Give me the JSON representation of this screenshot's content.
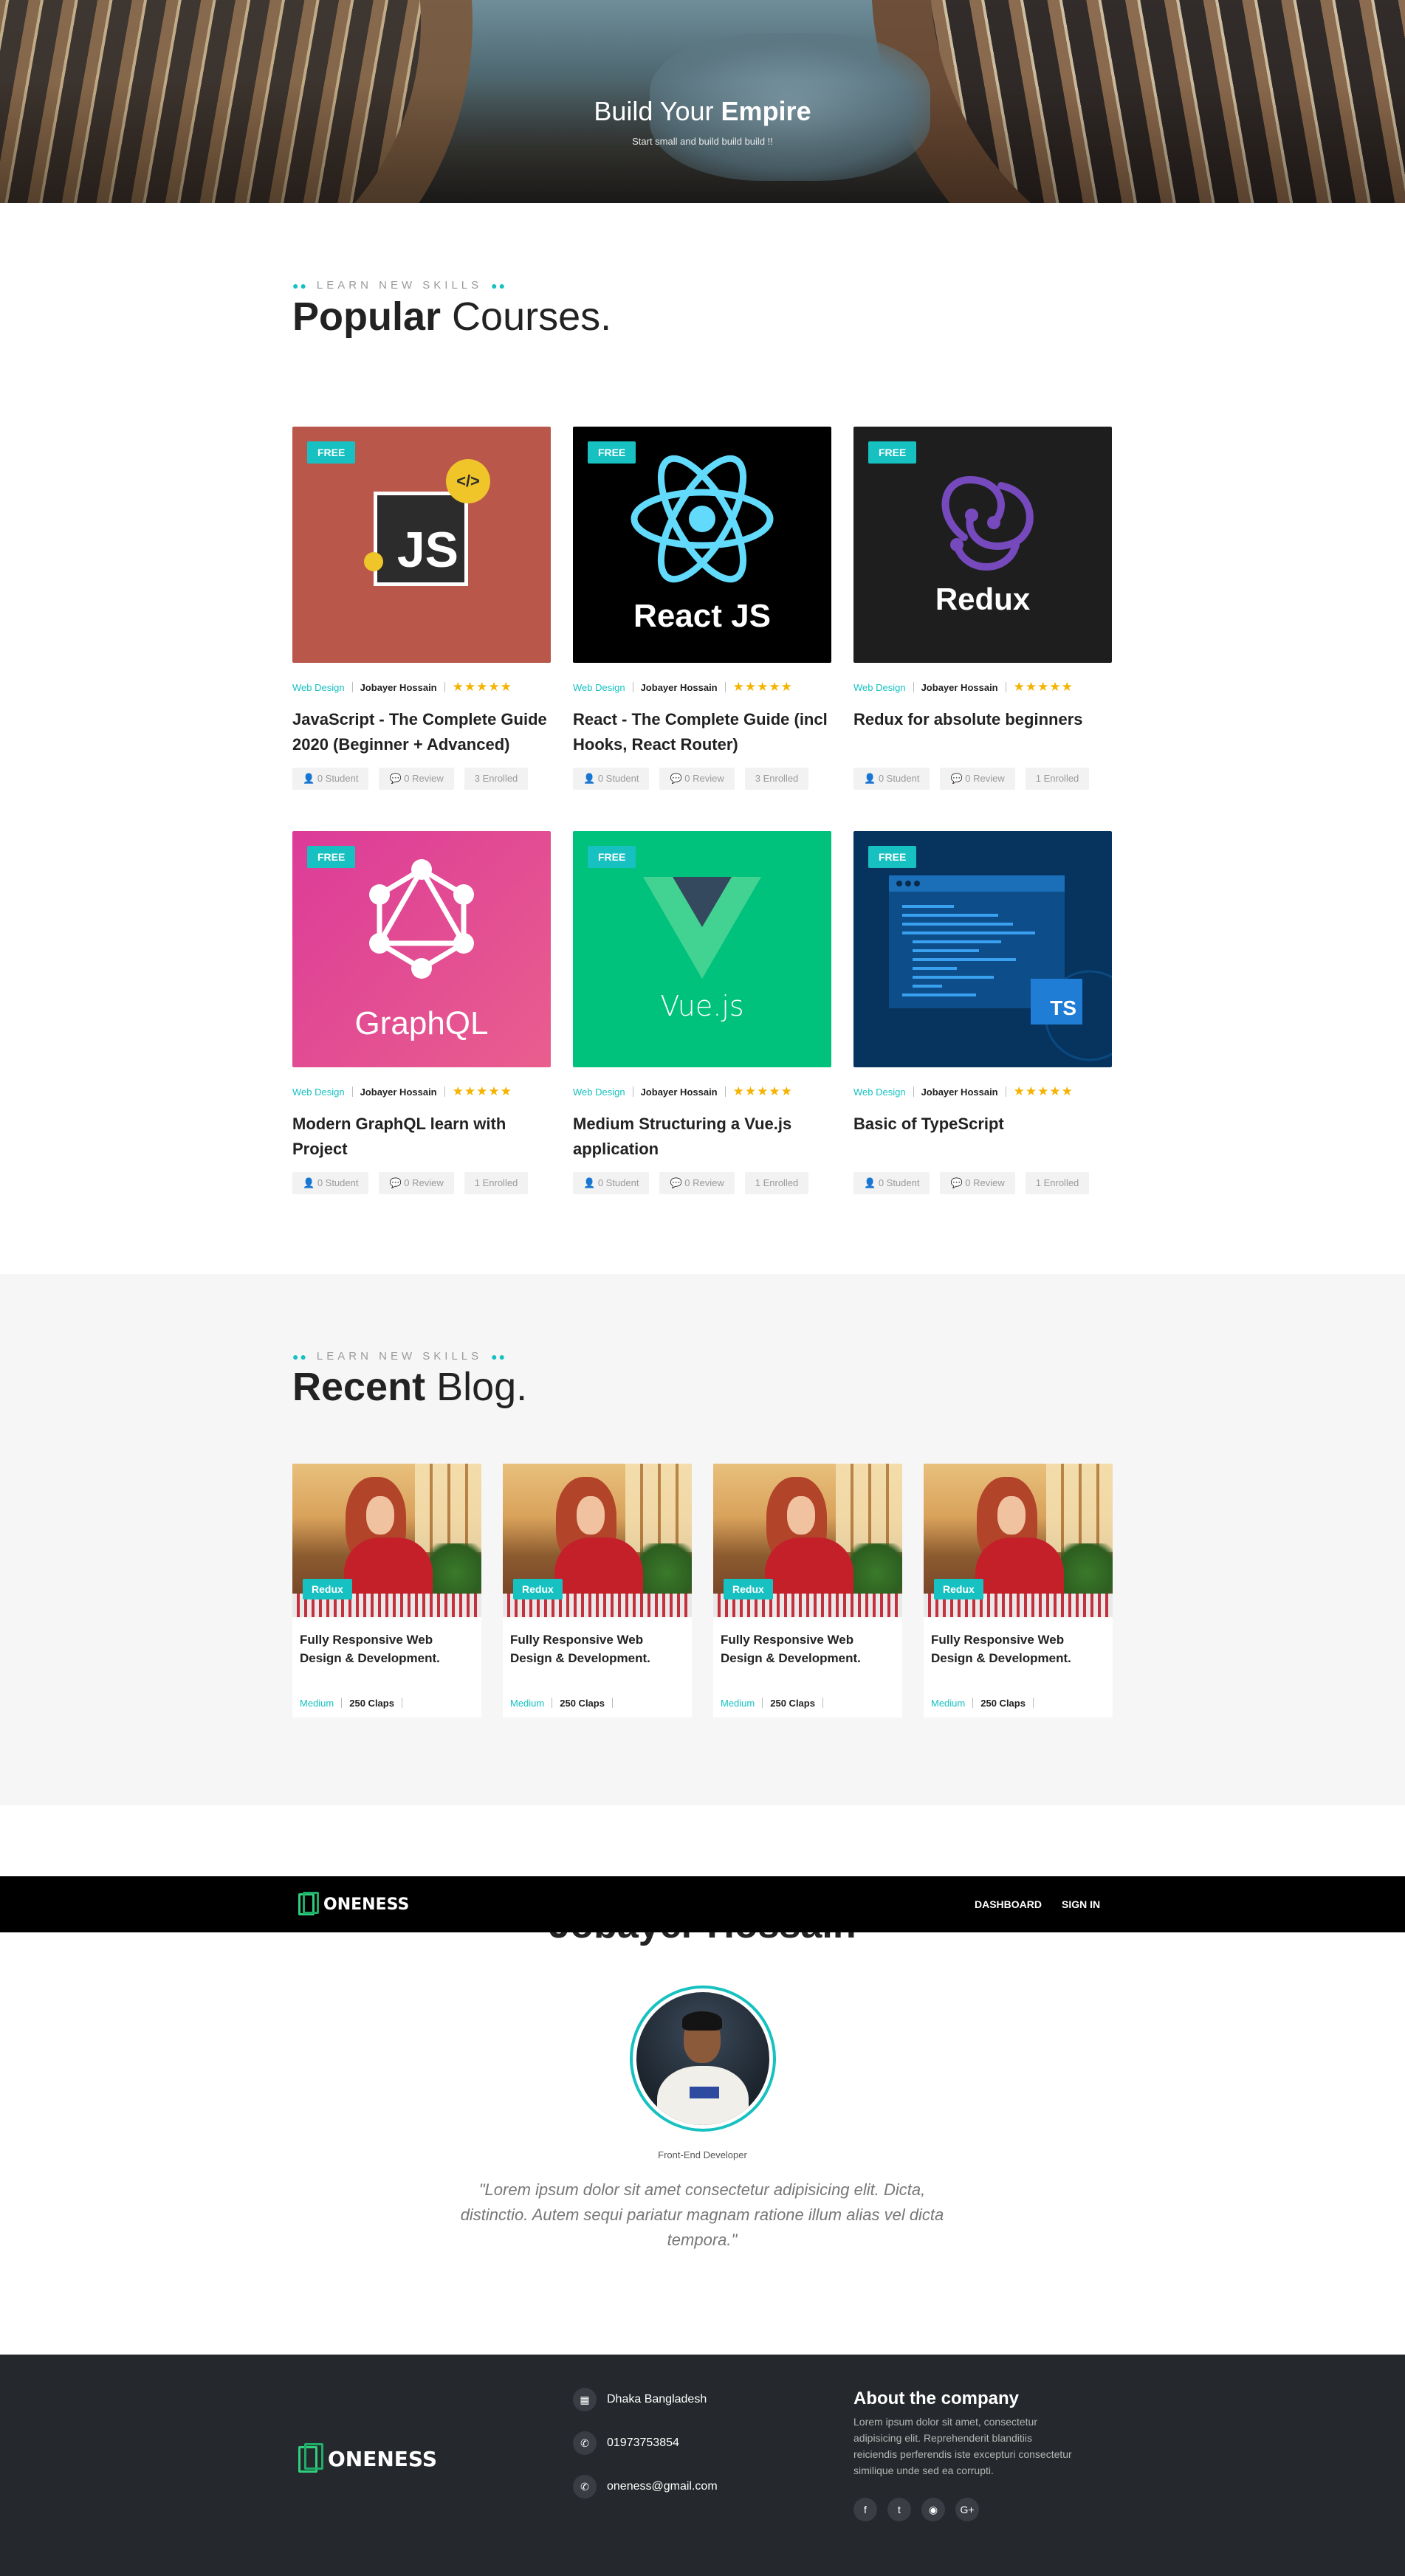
{
  "hero": {
    "title_prefix": "Build Your",
    "title_bold": "Empire",
    "subtitle": "Start small and build build build !!"
  },
  "courses_section": {
    "kicker": "LEARN NEW SKILLS",
    "title_bold": "Popular",
    "title_rest": "Courses."
  },
  "courses": [
    {
      "badge": "FREE",
      "image": "JS",
      "category": "Web Design",
      "author": "Jobayer Hossain",
      "rating": 5,
      "stars": "★★★★★",
      "title": "JavaScript - The Complete Guide 2020 (Beginner + Advanced)",
      "students": "0 Student",
      "reviews": "0 Review",
      "enrolled": "3 Enrolled"
    },
    {
      "badge": "FREE",
      "image": "React JS",
      "category": "Web Design",
      "author": "Jobayer Hossain",
      "rating": 5,
      "stars": "★★★★★",
      "title": "React - The Complete Guide (incl Hooks, React Router)",
      "students": "0 Student",
      "reviews": "0 Review",
      "enrolled": "3 Enrolled"
    },
    {
      "badge": "FREE",
      "image": "Redux",
      "category": "Web Design",
      "author": "Jobayer Hossain",
      "rating": 5,
      "stars": "★★★★★",
      "title": "Redux for absolute beginners",
      "students": "0 Student",
      "reviews": "0 Review",
      "enrolled": "1 Enrolled"
    },
    {
      "badge": "FREE",
      "image": "GraphQL",
      "category": "Web Design",
      "author": "Jobayer Hossain",
      "rating": 5,
      "stars": "★★★★★",
      "title": "Modern GraphQL learn with Project",
      "students": "0 Student",
      "reviews": "0 Review",
      "enrolled": "1 Enrolled"
    },
    {
      "badge": "FREE",
      "image": "Vue.js",
      "category": "Web Design",
      "author": "Jobayer Hossain",
      "rating": 5,
      "stars": "★★★★★",
      "title": "Medium Structuring a Vue.js application",
      "students": "0 Student",
      "reviews": "0 Review",
      "enrolled": "1 Enrolled"
    },
    {
      "badge": "FREE",
      "image": "TS",
      "category": "Web Design",
      "author": "Jobayer Hossain",
      "rating": 5,
      "stars": "★★★★★",
      "title": "Basic of TypeScript",
      "students": "0 Student",
      "reviews": "0 Review",
      "enrolled": "1 Enrolled"
    }
  ],
  "blog_section": {
    "kicker": "LEARN NEW SKILLS",
    "title_bold": "Recent",
    "title_rest": "Blog."
  },
  "posts": [
    {
      "badge": "Redux",
      "title": "Fully Responsive Web Design & Development.",
      "source": "Medium",
      "claps": "250 Claps"
    },
    {
      "badge": "Redux",
      "title": "Fully Responsive Web Design & Development.",
      "source": "Medium",
      "claps": "250 Claps"
    },
    {
      "badge": "Redux",
      "title": "Fully Responsive Web Design & Development.",
      "source": "Medium",
      "claps": "250 Claps"
    },
    {
      "badge": "Redux",
      "title": "Fully Responsive Web Design & Development.",
      "source": "Medium",
      "claps": "250 Claps"
    }
  ],
  "navbar": {
    "logo": "ONENESS",
    "links": [
      "DASHBOARD",
      "SIGN IN"
    ]
  },
  "profile": {
    "name_peek": "Jobayer Hossain",
    "role": "Front-End Developer",
    "quote": "\"Lorem ipsum dolor sit amet consectetur adipisicing elit. Dicta, distinctio. Autem sequi pariatur magnam ratione illum alias vel dicta tempora.\""
  },
  "footer": {
    "logo": "ONENESS",
    "contacts": [
      {
        "icon": "map-icon",
        "text": "Dhaka Bangladesh"
      },
      {
        "icon": "phone-icon",
        "text": "01973753854"
      },
      {
        "icon": "phone-icon",
        "text": "oneness@gmail.com"
      }
    ],
    "about_title": "About the company",
    "about_text": "Lorem ipsum dolor sit amet, consectetur adipisicing elit. Reprehenderit blanditiis reiciendis perferendis iste excepturi consectetur similique unde sed ea corrupti.",
    "social": [
      {
        "icon": "facebook-icon",
        "glyph": "f"
      },
      {
        "icon": "twitter-icon",
        "glyph": "t"
      },
      {
        "icon": "github-icon",
        "glyph": "◉"
      },
      {
        "icon": "google-plus-icon",
        "glyph": "G+"
      }
    ]
  },
  "colors": {
    "accent": "#17c1c1",
    "star": "#f5b300",
    "footer_bg": "#25282c",
    "blog_bg": "#f6f6f6",
    "nav_bg": "#000000"
  }
}
